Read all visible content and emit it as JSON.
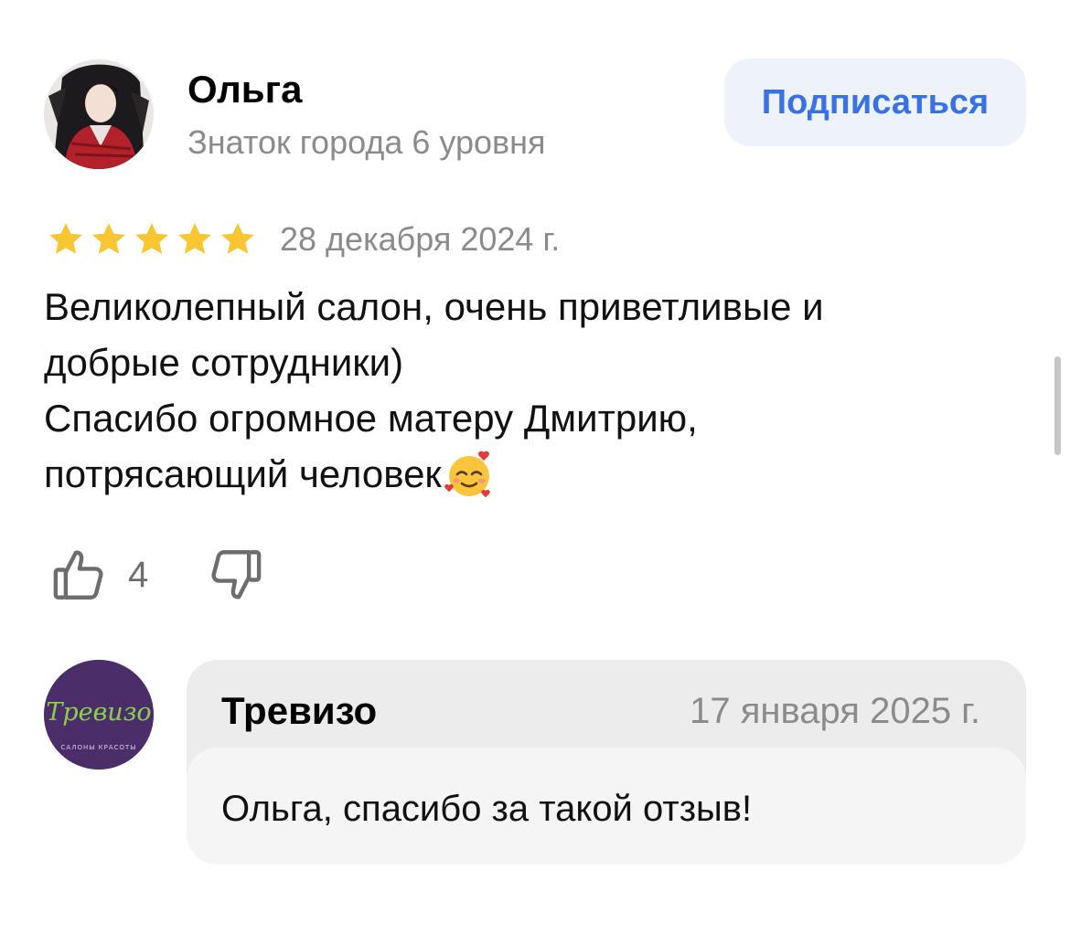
{
  "review": {
    "author": {
      "name": "Ольга",
      "level": "Знаток города 6 уровня"
    },
    "subscribe_label": "Подписаться",
    "rating": 5,
    "date": "28 декабря 2024 г.",
    "text": "Великолепный салон, очень приветливые и\nдобрые сотрудники)\nСпасибо огромное матеру Дмитрию,\nпотрясающий человек",
    "emoji": "smiling-face-with-hearts",
    "likes": "4"
  },
  "reply": {
    "avatar_logo_text": "Тревизо",
    "avatar_logo_subtext": "САЛОНЫ КРАСОТЫ",
    "author": "Тревизо",
    "date": "17 января 2025 г.",
    "text": "Ольга, спасибо за такой отзыв!"
  },
  "colors": {
    "accent": "#3872e5",
    "star": "#f7c631",
    "muted": "#8b8b8b",
    "reply_logo_bg": "#4b2d6a",
    "reply_logo_text": "#8ad04b"
  },
  "icons": [
    "star-icon",
    "thumbs-up-icon",
    "thumbs-down-icon"
  ]
}
